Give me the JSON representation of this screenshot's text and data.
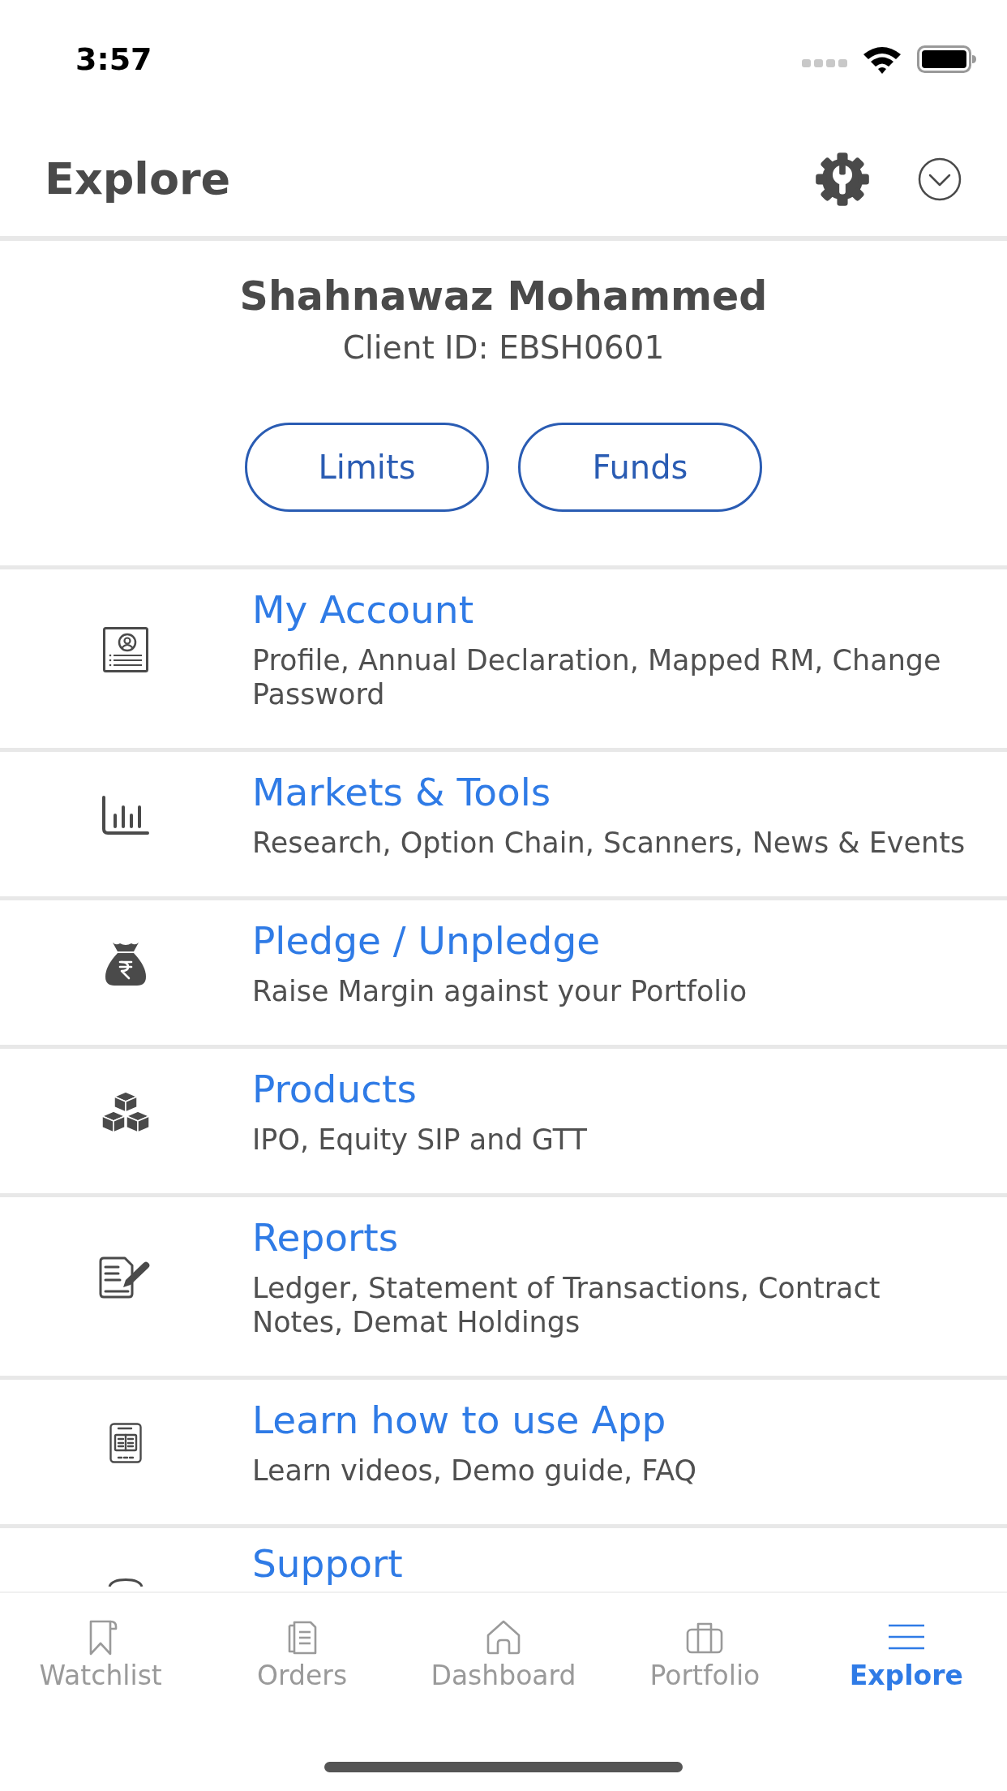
{
  "status_bar": {
    "time": "3:57"
  },
  "header": {
    "title": "Explore"
  },
  "profile": {
    "name": "Shahnawaz Mohammed",
    "client_id": "Client ID: EBSH0601",
    "buttons": [
      "Limits",
      "Funds"
    ]
  },
  "menu": [
    {
      "kind": "account",
      "title": "My Account",
      "description": "Profile, Annual Declaration, Mapped RM, Change Password"
    },
    {
      "kind": "chart",
      "title": "Markets & Tools",
      "description": "Research, Option Chain, Scanners, News & Events"
    },
    {
      "kind": "money-bag",
      "title": "Pledge / Unpledge",
      "description": "Raise Margin against your Portfolio"
    },
    {
      "kind": "cubes",
      "title": "Products",
      "description": "IPO, Equity SIP and GTT"
    },
    {
      "kind": "report",
      "title": "Reports",
      "description": "Ledger, Statement of Transactions, Contract Notes, Demat Holdings"
    },
    {
      "kind": "tablet",
      "title": "Learn how to use App",
      "description": "Learn videos, Demo guide, FAQ"
    },
    {
      "kind": "support",
      "title": "Support"
    }
  ],
  "tab_bar": [
    {
      "kind": "bookmark",
      "label": "Watchlist",
      "selected": false
    },
    {
      "kind": "orders",
      "label": "Orders",
      "selected": false
    },
    {
      "kind": "home",
      "label": "Dashboard",
      "selected": false
    },
    {
      "kind": "briefcase",
      "label": "Portfolio",
      "selected": false
    },
    {
      "kind": "menu",
      "label": "Explore",
      "selected": true
    }
  ]
}
